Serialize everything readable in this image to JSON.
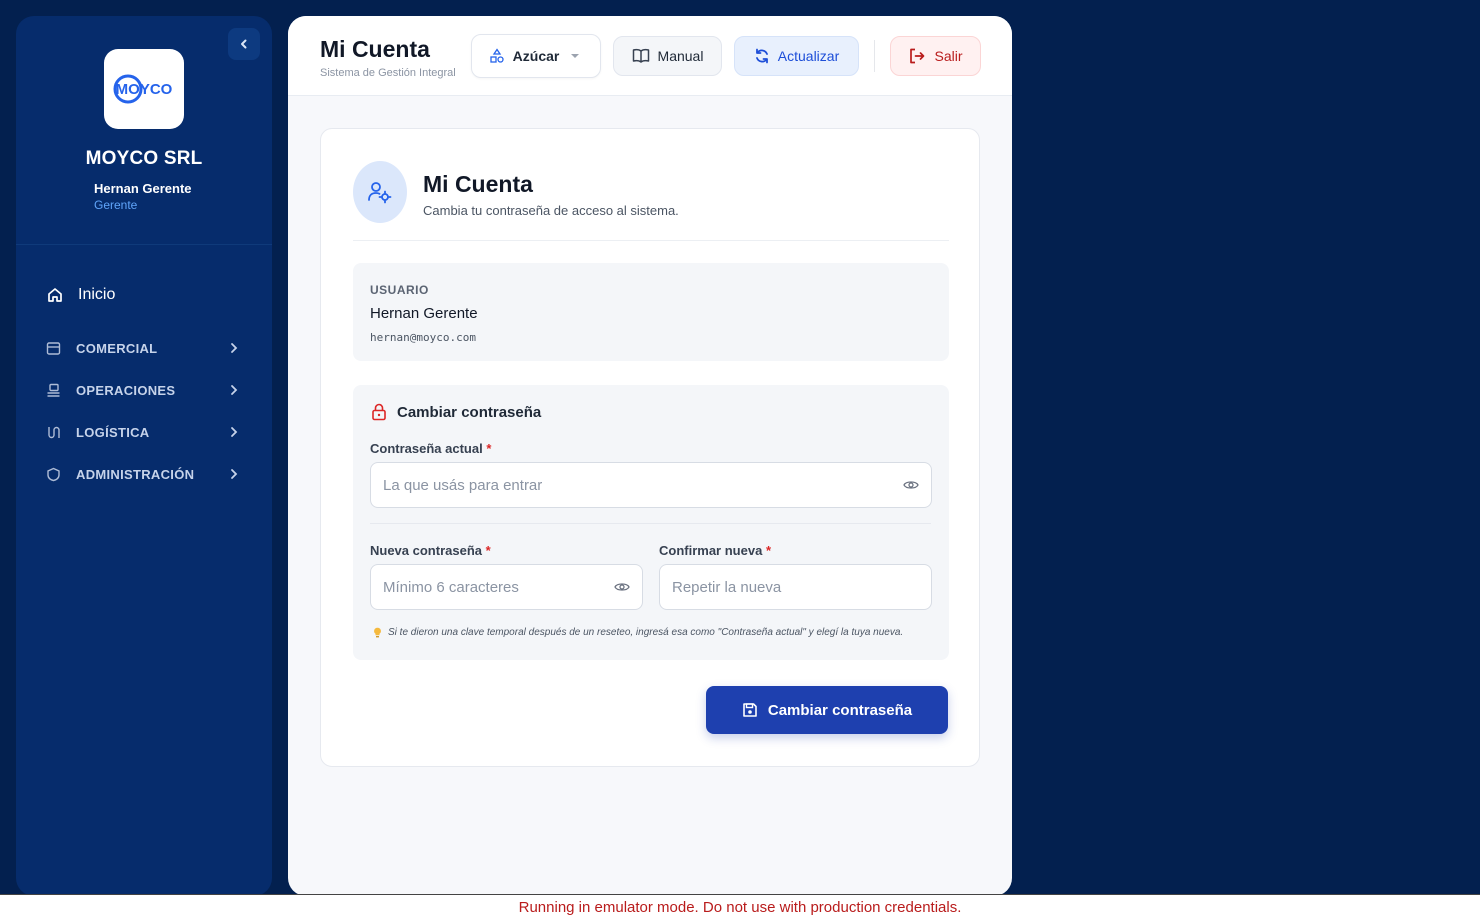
{
  "sidebar": {
    "company": "MOYCO SRL",
    "logo_text": "MOYCO",
    "user_name": "Hernan Gerente",
    "user_role": "Gerente",
    "home_label": "Inicio",
    "items": [
      {
        "label": "COMERCIAL",
        "icon": "store-icon"
      },
      {
        "label": "OPERACIONES",
        "icon": "operations-icon"
      },
      {
        "label": "LOGÍSTICA",
        "icon": "route-icon"
      },
      {
        "label": "ADMINISTRACIÓN",
        "icon": "admin-icon"
      }
    ]
  },
  "header": {
    "title": "Mi Cuenta",
    "subtitle": "Sistema de Gestión Integral",
    "product_select": "Azúcar",
    "manual_label": "Manual",
    "refresh_label": "Actualizar",
    "logout_label": "Salir"
  },
  "card": {
    "title": "Mi Cuenta",
    "subtitle": "Cambia tu contraseña de acceso al sistema.",
    "user_section_label": "USUARIO",
    "user_name": "Hernan Gerente",
    "user_email": "hernan@moyco.com",
    "change_password_heading": "Cambiar contraseña",
    "current_password_label": "Contraseña actual",
    "current_password_placeholder": "La que usás para entrar",
    "new_password_label": "Nueva contraseña",
    "new_password_placeholder": "Mínimo 6 caracteres",
    "confirm_password_label": "Confirmar nueva",
    "confirm_password_placeholder": "Repetir la nueva",
    "required_mark": "*",
    "hint": "Si te dieron una clave temporal después de un reseteo, ingresá esa como \"Contraseña actual\" y elegí la tuya nueva.",
    "submit_label": "Cambiar contraseña"
  },
  "banner": {
    "text": "Running in emulator mode. Do not use with production credentials."
  },
  "colors": {
    "background": "#03204f",
    "sidebar": "#062c6c",
    "accent": "#1e40af",
    "danger": "#b91c1c",
    "role": "#60a5fa"
  }
}
